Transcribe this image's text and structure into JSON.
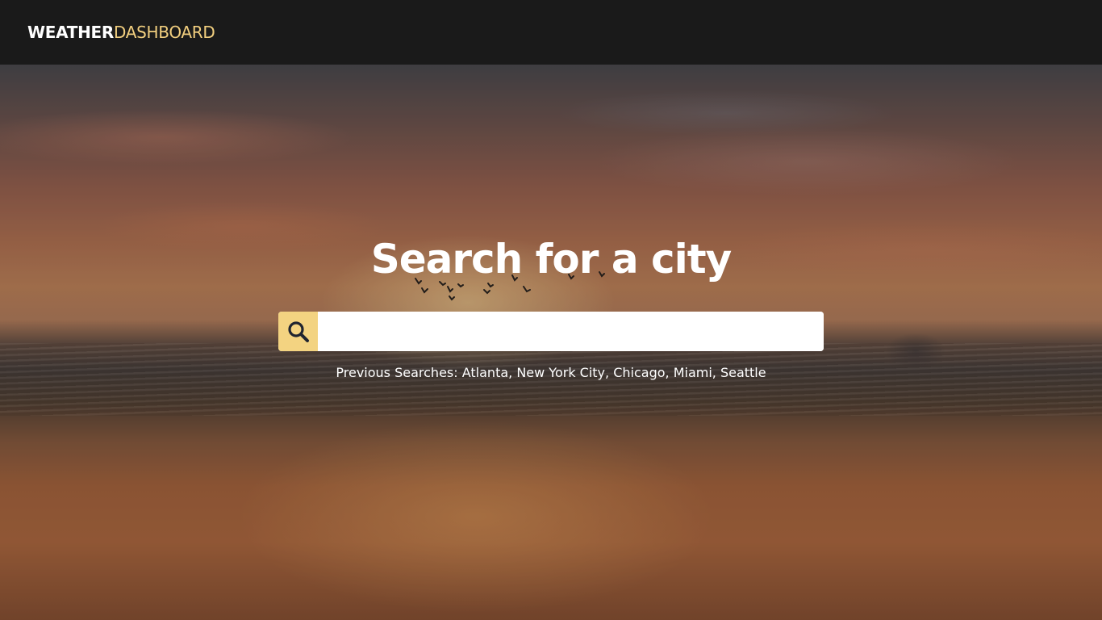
{
  "header": {
    "brand_part1": "WEATHER",
    "brand_part2": "DASHBOARD"
  },
  "hero": {
    "title": "Search for a city"
  },
  "search": {
    "value": "",
    "placeholder": "",
    "icon": "search-icon"
  },
  "previous_searches": {
    "label": "Previous Searches:",
    "cities": [
      "Atlanta",
      "New York City",
      "Chicago",
      "Miami",
      "Seattle"
    ]
  },
  "colors": {
    "navbar_bg": "#1a1a1a",
    "accent": "#f2cf7f",
    "search_button_bg": "#f3d381"
  }
}
